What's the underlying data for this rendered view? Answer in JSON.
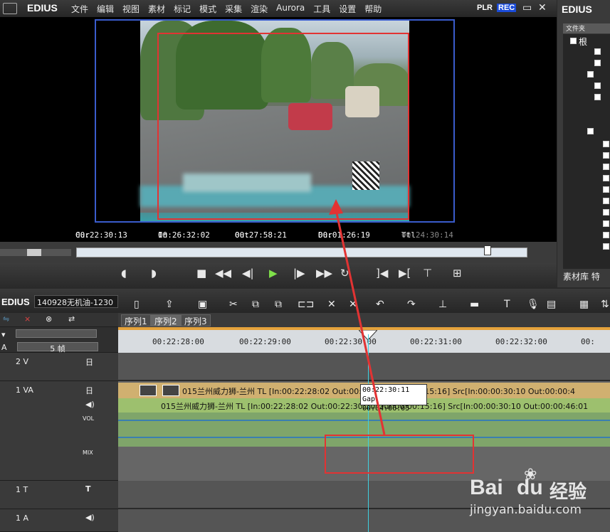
{
  "app": {
    "logo": "EDIUS",
    "plr": "PLR",
    "rec": "REC"
  },
  "menu": [
    "文件",
    "编辑",
    "视图",
    "素材",
    "标记",
    "模式",
    "采集",
    "渲染",
    "Aurora",
    "工具",
    "设置",
    "帮助"
  ],
  "window": {
    "minimize": "▭",
    "close": "✕"
  },
  "timecodes": {
    "cur_label": "Cur",
    "cur": "00:22:30:13",
    "in_label": "In",
    "in": "00:26:32:02",
    "out_label": "Out",
    "out": "00:27:58:21",
    "dur_label": "Dur",
    "dur": "00:01:26:19",
    "ttl_label": "Ttl",
    "ttl": "00:24:30:14"
  },
  "right_panel": {
    "title": "EDIUS",
    "header": "文件夹",
    "root": "根",
    "tabs": [
      "素材库",
      "特"
    ]
  },
  "timeline": {
    "logo": "EDIUS",
    "project": "140928无机油-1230",
    "tabs": [
      "序列1",
      "序列2",
      "序列3"
    ],
    "ruler": [
      "00:22:28:00",
      "00:22:29:00",
      "00:22:30:00",
      "00:22:31:00",
      "00:22:32:00",
      "00:"
    ],
    "zoom": "5 帧",
    "tracks": {
      "v2": "2 V",
      "va": "1 VA",
      "t": "1 T",
      "a": "1 A",
      "vol": "VOL",
      "mix": "MIX"
    },
    "clip_video": "015兰州威力狮-兰州  TL [In:00:22:28:02 Out:00:00:00:00 00:00:15:16]  Src[In:00:00:30:10 Out:00:00:4",
    "clip_audio": "015兰州威力狮-兰州  TL [In:00:22:28:02 Out:00:22:30:10 Dur:00:00:15:16]  Src[In:00:00:30:10 Out:00:00:46:01",
    "tooltip_line1": "00:22:30:11",
    "tooltip_line2": "Gap  00:04:06:05"
  },
  "watermark": {
    "brand": "Bai",
    "brand2": "du",
    "cn": "经验",
    "url": "jingyan.baidu.com"
  },
  "colors": {
    "accent_blue": "#3a5ccc",
    "highlight_red": "#e23333",
    "cursor": "#3fd0e0"
  }
}
